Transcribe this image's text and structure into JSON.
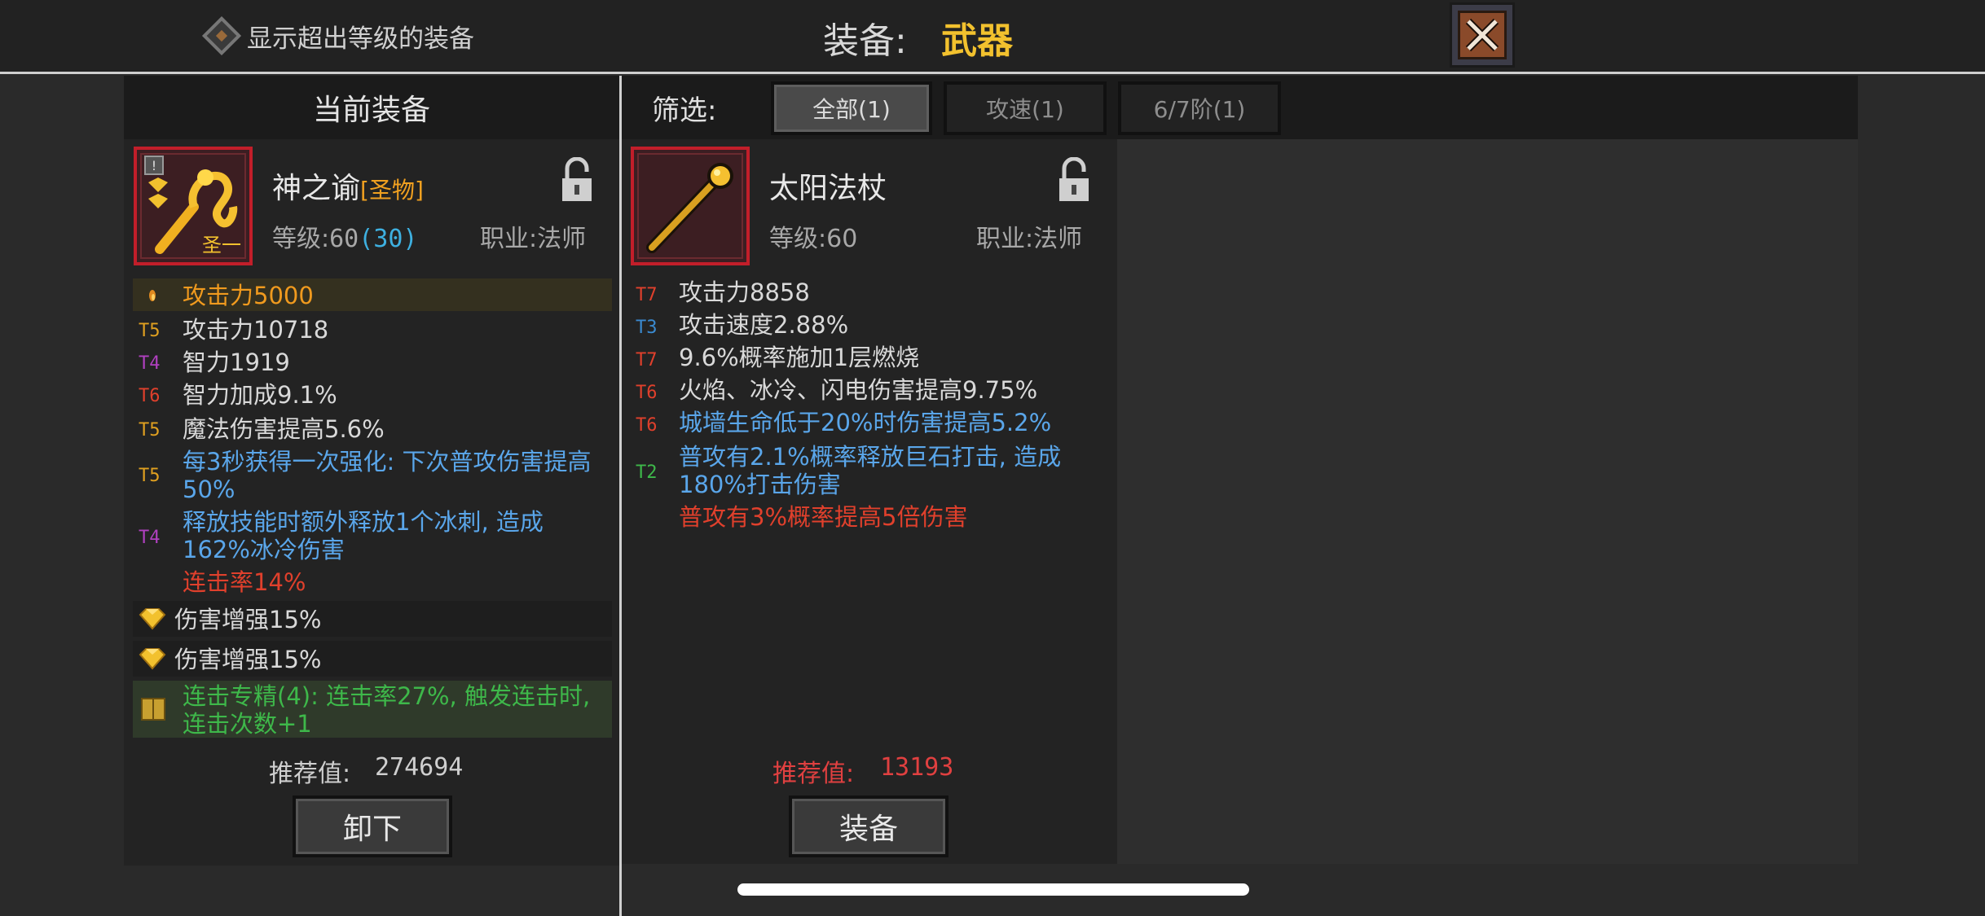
{
  "header": {
    "show_over_level_label": "显示超出等级的装备",
    "title_prefix": "装备:",
    "title_value": "武器",
    "close_icon": "close-x-icon"
  },
  "current": {
    "panel_title": "当前装备",
    "item": {
      "name": "神之谕",
      "tag": "[圣物]",
      "level_label": "等级:",
      "level_value": "60",
      "level_extra": "(30)",
      "class_text": "职业:法师",
      "icon_badge": "圣一",
      "icon": "golden-snake-staff-icon"
    },
    "main_stat": "攻击力5000",
    "stats": [
      {
        "tier": "T5",
        "text": "攻击力10718",
        "tier_color": "#e0a020"
      },
      {
        "tier": "T4",
        "text": "智力1919",
        "tier_color": "#b040c0"
      },
      {
        "tier": "T6",
        "text": "智力加成9.1%",
        "tier_color": "#e0402c"
      },
      {
        "tier": "T5",
        "text": "魔法伤害提高5.6%",
        "tier_color": "#e0a020"
      },
      {
        "tier": "T5",
        "text": "每3秒获得一次强化: 下次普攻伤害提高50%",
        "tier_color": "#e0a020"
      },
      {
        "tier": "T4",
        "text": "释放技能时额外释放1个冰刺, 造成162%冰冷伤害",
        "tier_color": "#b040c0"
      }
    ],
    "special": "连击率14%",
    "gems": [
      "伤害增强15%",
      "伤害增强15%"
    ],
    "set_bonus": "连击专精(4): 连击率27%, 触发连击时, 连击次数+1",
    "score_label": "推荐值:",
    "score_value": "274694",
    "unequip_label": "卸下"
  },
  "filter": {
    "label": "筛选:",
    "tabs": [
      "全部(1)",
      "攻速(1)",
      "6/7阶(1)"
    ]
  },
  "candidate": {
    "item": {
      "name": "太阳法杖",
      "level_text": "等级:60",
      "class_text": "职业:法师",
      "icon": "sun-staff-icon"
    },
    "stats": [
      {
        "tier": "T7",
        "text": "攻击力8858",
        "tier_color": "#e0402c",
        "style": "normal"
      },
      {
        "tier": "T3",
        "text": "攻击速度2.88%",
        "tier_color": "#3a8ad0",
        "style": "normal"
      },
      {
        "tier": "T7",
        "text": "9.6%概率施加1层燃烧",
        "tier_color": "#e0402c",
        "style": "normal"
      },
      {
        "tier": "T6",
        "text": "火焰、冰冷、闪电伤害提高9.75%",
        "tier_color": "#e0402c",
        "style": "normal"
      },
      {
        "tier": "T6",
        "text": "城墙生命低于20%时伤害提高5.2%",
        "tier_color": "#e0402c",
        "style": "blue"
      },
      {
        "tier": "T2",
        "text": "普攻有2.1%概率释放巨石打击, 造成180%打击伤害",
        "tier_color": "#3eb84a",
        "style": "blue"
      }
    ],
    "special": "普攻有3%概率提高5倍伤害",
    "score_label": "推荐值:",
    "score_value": "13193",
    "equip_label": "装备"
  }
}
